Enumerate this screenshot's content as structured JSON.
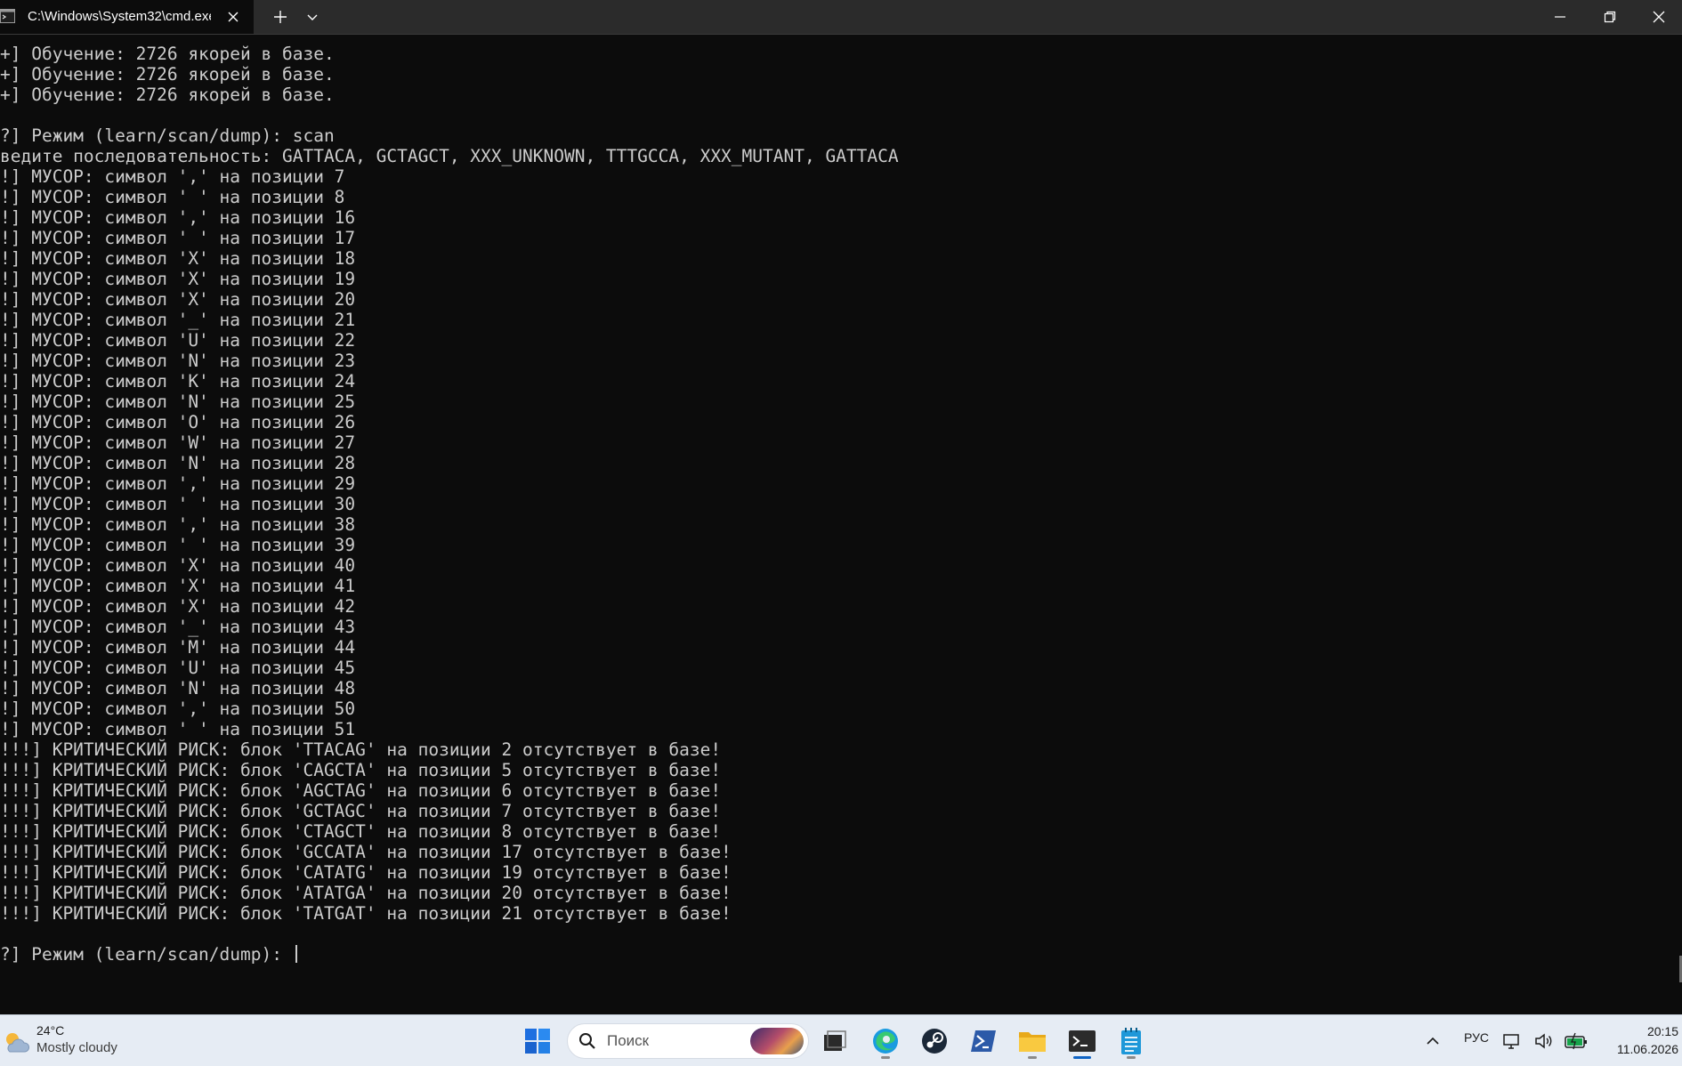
{
  "window": {
    "tab_title": "C:\\Windows\\System32\\cmd.exe"
  },
  "terminal": {
    "lines": [
      "+] Обучение: 2726 якорей в базе.",
      "+] Обучение: 2726 якорей в базе.",
      "+] Обучение: 2726 якорей в базе.",
      "",
      "?] Режим (learn/scan/dump): scan",
      "ведите последовательность: GATTACA, GCTAGCT, XXX_UNKNOWN, TTTGCCA, XXX_MUTANT, GATTACA",
      "!] МУСОР: символ ',' на позиции 7",
      "!] МУСОР: символ ' ' на позиции 8",
      "!] МУСОР: символ ',' на позиции 16",
      "!] МУСОР: символ ' ' на позиции 17",
      "!] МУСОР: символ 'X' на позиции 18",
      "!] МУСОР: символ 'X' на позиции 19",
      "!] МУСОР: символ 'X' на позиции 20",
      "!] МУСОР: символ '_' на позиции 21",
      "!] МУСОР: символ 'U' на позиции 22",
      "!] МУСОР: символ 'N' на позиции 23",
      "!] МУСОР: символ 'K' на позиции 24",
      "!] МУСОР: символ 'N' на позиции 25",
      "!] МУСОР: символ 'O' на позиции 26",
      "!] МУСОР: символ 'W' на позиции 27",
      "!] МУСОР: символ 'N' на позиции 28",
      "!] МУСОР: символ ',' на позиции 29",
      "!] МУСОР: символ ' ' на позиции 30",
      "!] МУСОР: символ ',' на позиции 38",
      "!] МУСОР: символ ' ' на позиции 39",
      "!] МУСОР: символ 'X' на позиции 40",
      "!] МУСОР: символ 'X' на позиции 41",
      "!] МУСОР: символ 'X' на позиции 42",
      "!] МУСОР: символ '_' на позиции 43",
      "!] МУСОР: символ 'M' на позиции 44",
      "!] МУСОР: символ 'U' на позиции 45",
      "!] МУСОР: символ 'N' на позиции 48",
      "!] МУСОР: символ ',' на позиции 50",
      "!] МУСОР: символ ' ' на позиции 51",
      "!!!] КРИТИЧЕСКИЙ РИСК: блок 'TTACAG' на позиции 2 отсутствует в базе!",
      "!!!] КРИТИЧЕСКИЙ РИСК: блок 'CAGCTA' на позиции 5 отсутствует в базе!",
      "!!!] КРИТИЧЕСКИЙ РИСК: блок 'AGCTAG' на позиции 6 отсутствует в базе!",
      "!!!] КРИТИЧЕСКИЙ РИСК: блок 'GCTAGC' на позиции 7 отсутствует в базе!",
      "!!!] КРИТИЧЕСКИЙ РИСК: блок 'CTAGCT' на позиции 8 отсутствует в базе!",
      "!!!] КРИТИЧЕСКИЙ РИСК: блок 'GCCATA' на позиции 17 отсутствует в базе!",
      "!!!] КРИТИЧЕСКИЙ РИСК: блок 'CATATG' на позиции 19 отсутствует в базе!",
      "!!!] КРИТИЧЕСКИЙ РИСК: блок 'ATATGA' на позиции 20 отсутствует в базе!",
      "!!!] КРИТИЧЕСКИЙ РИСК: блок 'TATGAT' на позиции 21 отсутствует в базе!",
      ""
    ],
    "prompt": "?] Режим (learn/scan/dump): "
  },
  "taskbar": {
    "weather": {
      "temp": "24°C",
      "condition": "Mostly cloudy"
    },
    "search_placeholder": "Поиск",
    "language": "РУС",
    "time": "20:15",
    "date": "11.06.2026"
  },
  "colors": {
    "terminal_bg": "#0c0c0c",
    "terminal_fg": "#cccccc",
    "titlebar_bg": "#2b2b2b",
    "taskbar_bg": "#e6ecf4"
  }
}
